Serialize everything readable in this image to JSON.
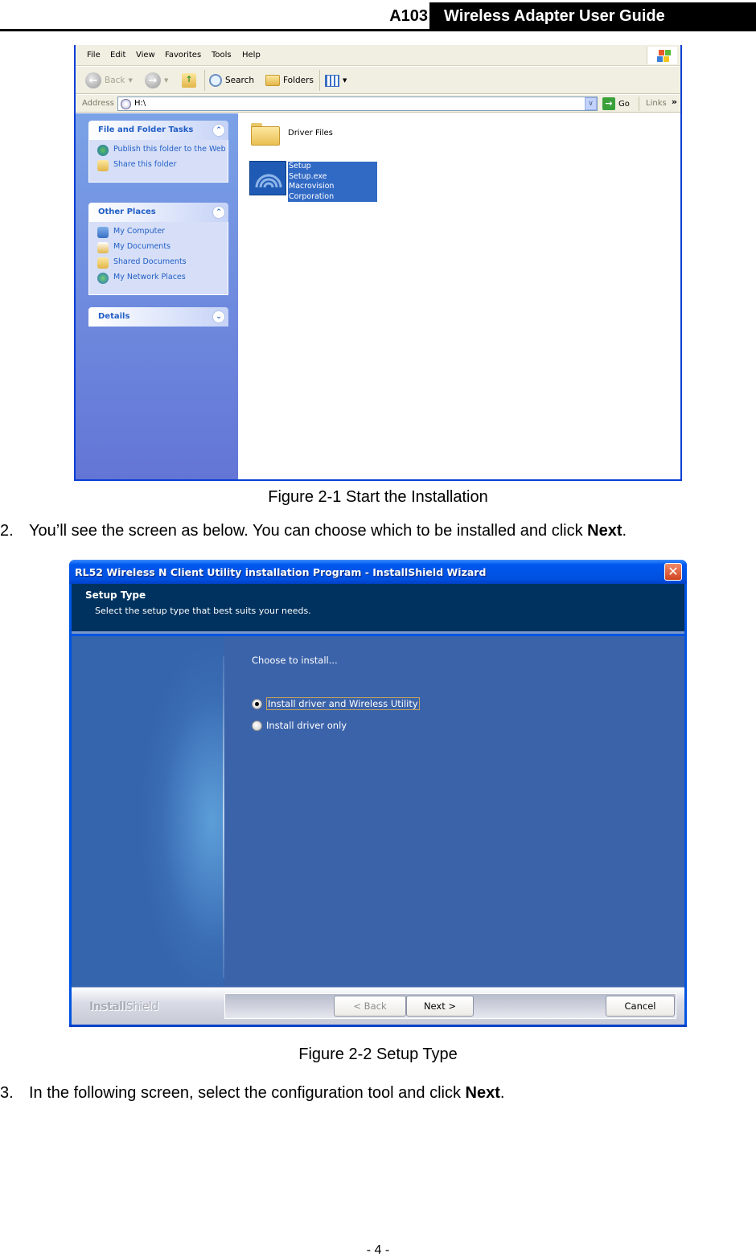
{
  "header": {
    "model": "A103",
    "guide_title": "Wireless Adapter User Guide"
  },
  "figure1": {
    "menu": [
      "File",
      "Edit",
      "View",
      "Favorites",
      "Tools",
      "Help"
    ],
    "toolbar": {
      "back": "Back",
      "search": "Search",
      "folders": "Folders"
    },
    "address": {
      "label": "Address",
      "value": "H:\\",
      "go": "Go",
      "links": "Links"
    },
    "panels": [
      {
        "title": "File and Folder Tasks",
        "toggle": "collapse",
        "items": [
          "Publish this folder to the Web",
          "Share this folder"
        ]
      },
      {
        "title": "Other Places",
        "toggle": "collapse",
        "items": [
          "My Computer",
          "My Documents",
          "Shared Documents",
          "My Network Places"
        ]
      },
      {
        "title": "Details",
        "toggle": "expand",
        "items": []
      }
    ],
    "files": {
      "folder_name": "Driver Files",
      "setup_lines": [
        "Setup",
        "Setup.exe",
        "Macrovision Corporation"
      ]
    },
    "caption": "Figure 2-1 Start the Installation"
  },
  "step2": {
    "number": "2.",
    "text": "You’ll see the screen as below. You can choose which to be installed and click ",
    "bold": "Next",
    "end": "."
  },
  "figure2": {
    "window_title": "RL52 Wireless N Client Utility installation Program - InstallShield Wizard",
    "banner_title": "Setup Type",
    "banner_subtitle": "Select the setup type that best suits your needs.",
    "prompt": "Choose to install...",
    "options": [
      {
        "label": "Install driver and Wireless Utility",
        "selected": true
      },
      {
        "label": "Install driver only",
        "selected": false
      }
    ],
    "brand_bold": "Install",
    "brand_light": "Shield",
    "buttons": {
      "back": "< Back",
      "next": "Next >",
      "cancel": "Cancel"
    },
    "caption": "Figure 2-2 Setup Type"
  },
  "step3": {
    "number": "3.",
    "text": "In the following screen, select the configuration tool and click ",
    "bold": "Next",
    "end": "."
  },
  "page_number": "- 4 -"
}
